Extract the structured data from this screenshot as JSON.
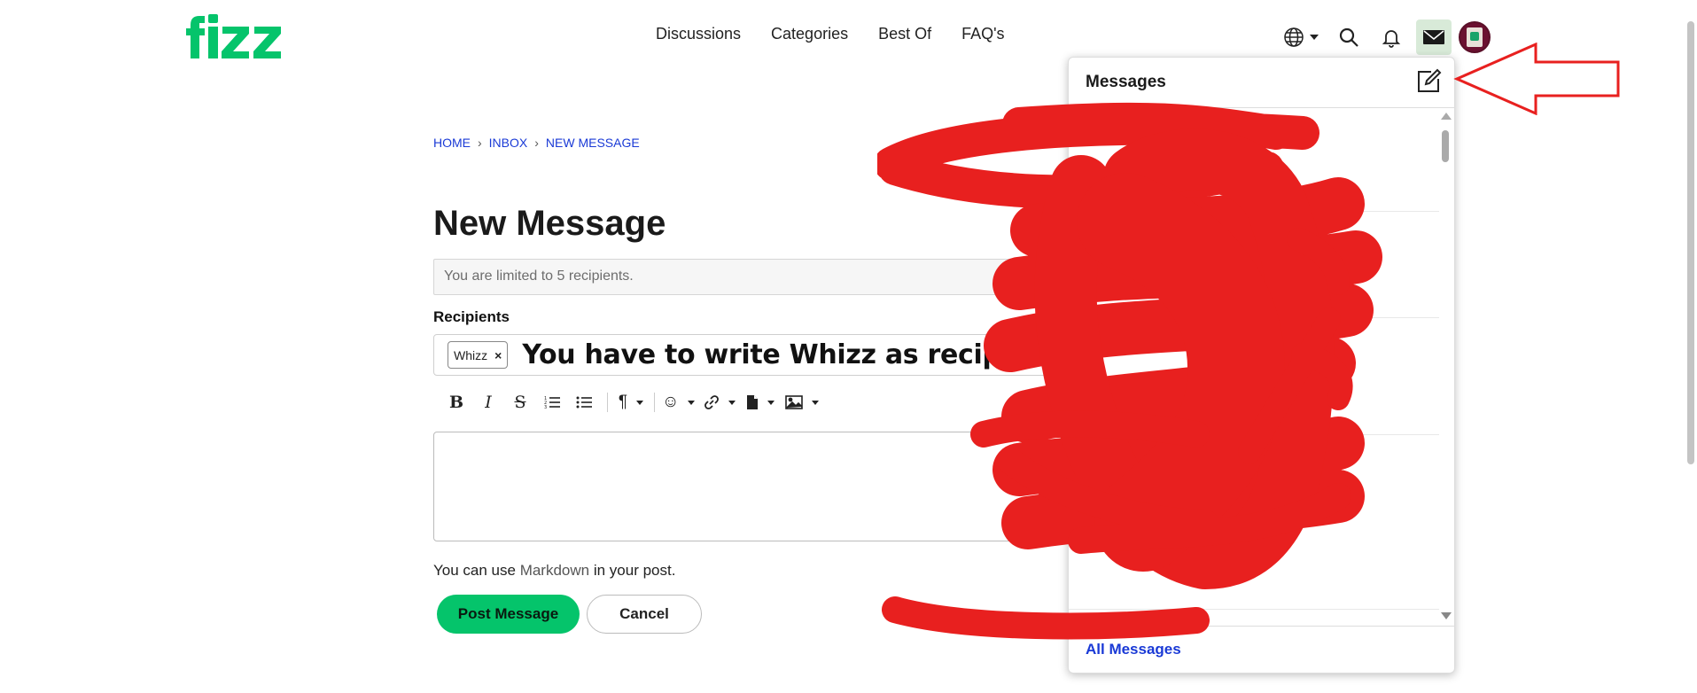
{
  "brand": {
    "name": "fizz",
    "color": "#05c46b"
  },
  "nav": {
    "items": [
      {
        "label": "Discussions"
      },
      {
        "label": "Categories"
      },
      {
        "label": "Best Of"
      },
      {
        "label": "FAQ's"
      }
    ]
  },
  "header_tools": {
    "icons": [
      "globe-icon",
      "search-icon",
      "bell-icon",
      "envelope-icon",
      "avatar"
    ],
    "active": "envelope-icon"
  },
  "breadcrumb": {
    "items": [
      {
        "label": "HOME"
      },
      {
        "label": "INBOX"
      },
      {
        "label": "NEW MESSAGE"
      }
    ],
    "separator": "›"
  },
  "page": {
    "title": "New Message",
    "limit_notice": "You are limited to 5 recipients."
  },
  "recipients": {
    "label": "Recipients",
    "tokens": [
      {
        "name": "Whizz",
        "remove": "×"
      }
    ],
    "annotation": "You have to write Whizz as recipient"
  },
  "toolbar": {
    "bold": "B",
    "italic": "I",
    "strike": "S",
    "paragraph": "¶",
    "emoji": "☺",
    "link": "🔗",
    "file": "📄",
    "image": "🖼"
  },
  "editor": {
    "value": ""
  },
  "markdown_note": {
    "before": "You can use ",
    "link": "Markdown",
    "after": " in your post."
  },
  "actions": {
    "post_label": "Post Message",
    "cancel_label": "Cancel"
  },
  "flyout": {
    "title": "Messages",
    "footer_link": "All Messages"
  },
  "colors": {
    "accent": "#05c46b",
    "link": "#1a3ad6",
    "annotation": "#e8201f"
  }
}
